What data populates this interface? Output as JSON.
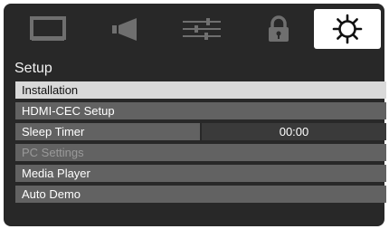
{
  "tabs": [
    {
      "name": "picture",
      "icon": "tv-screen-icon",
      "active": false
    },
    {
      "name": "sound",
      "icon": "speaker-icon",
      "active": false
    },
    {
      "name": "adjust",
      "icon": "sliders-icon",
      "active": false
    },
    {
      "name": "lock",
      "icon": "lock-icon",
      "active": false
    },
    {
      "name": "setup",
      "icon": "gear-icon",
      "active": true
    }
  ],
  "menu": {
    "title": "Setup",
    "items": [
      {
        "label": "Installation",
        "state": "selected"
      },
      {
        "label": "HDMI-CEC Setup",
        "state": "normal"
      },
      {
        "label": "Sleep Timer",
        "value": "00:00",
        "state": "normal"
      },
      {
        "label": "PC Settings",
        "state": "disabled"
      },
      {
        "label": "Media Player",
        "state": "normal"
      },
      {
        "label": "Auto Demo",
        "state": "normal"
      }
    ]
  },
  "colors": {
    "background": "#282828",
    "item": "#626262",
    "selected": "#d9d9d9",
    "disabled_text": "#9a9a9a",
    "active_tab": "#ffffff"
  }
}
